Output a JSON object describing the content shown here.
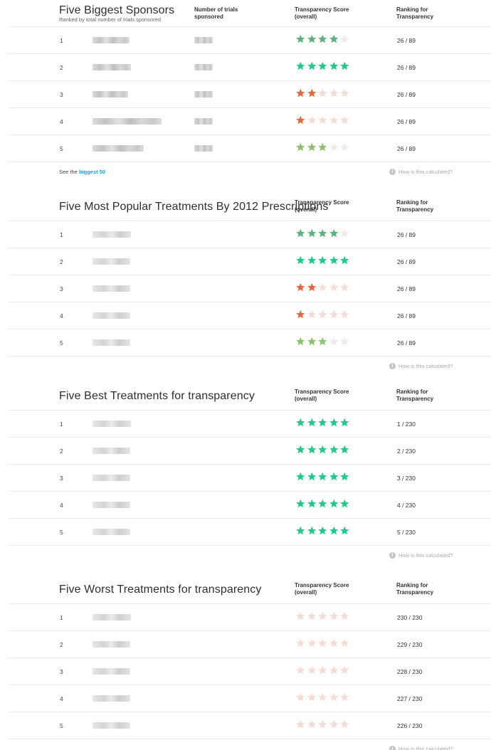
{
  "colors": {
    "star_green_bright": "#21c98a",
    "star_green_mid": "#5bb37f",
    "star_green_olive": "#8ec26a",
    "star_orange": "#e8683a",
    "star_empty_green": "#e4f1e2",
    "star_empty_pink": "#fadbd3",
    "link_blue": "#1a9fd6"
  },
  "common": {
    "col_score": "Transparency Score\n(overall)",
    "col_rank": "Ranking for\nTransparency",
    "how_calc": "How is this calculated?"
  },
  "sponsors": {
    "title": "Five Biggest Sponsors",
    "subtitle": "Ranked by total number of trials sponsored",
    "col_trials": "Number of trials\nsponsored",
    "see_prefix": "See the",
    "see_link": "biggest 50",
    "rows": [
      {
        "rank": "1",
        "stars": 4,
        "palette": "mid",
        "ranking": "26 / 89"
      },
      {
        "rank": "2",
        "stars": 5,
        "palette": "bright",
        "ranking": "26 / 89"
      },
      {
        "rank": "3",
        "stars": 2,
        "palette": "orange",
        "ranking": "26 / 89"
      },
      {
        "rank": "4",
        "stars": 1,
        "palette": "orange",
        "ranking": "26 / 89"
      },
      {
        "rank": "5",
        "stars": 3,
        "palette": "olive",
        "ranking": "26 / 89"
      }
    ]
  },
  "popular": {
    "title": "Five Most Popular Treatments By 2012 Prescriptions",
    "rows": [
      {
        "rank": "1",
        "stars": 4,
        "palette": "mid",
        "ranking": "26 / 89"
      },
      {
        "rank": "2",
        "stars": 5,
        "palette": "bright",
        "ranking": "26 / 89"
      },
      {
        "rank": "3",
        "stars": 2,
        "palette": "orange",
        "ranking": "26 / 89"
      },
      {
        "rank": "4",
        "stars": 1,
        "palette": "orange",
        "ranking": "26 / 89"
      },
      {
        "rank": "5",
        "stars": 3,
        "palette": "olive",
        "ranking": "26 / 89"
      }
    ]
  },
  "best": {
    "title": "Five Best Treatments for transparency",
    "rows": [
      {
        "rank": "1",
        "stars": 5,
        "palette": "bright",
        "ranking": "1 / 230"
      },
      {
        "rank": "2",
        "stars": 5,
        "palette": "bright",
        "ranking": "2 / 230"
      },
      {
        "rank": "3",
        "stars": 5,
        "palette": "bright",
        "ranking": "3 / 230"
      },
      {
        "rank": "4",
        "stars": 5,
        "palette": "bright",
        "ranking": "4 / 230"
      },
      {
        "rank": "5",
        "stars": 5,
        "palette": "bright",
        "ranking": "5 / 230"
      }
    ]
  },
  "worst": {
    "title": "Five Worst Treatments for transparency",
    "rows": [
      {
        "rank": "1",
        "stars": 0,
        "palette": "pink",
        "ranking": "230 / 230"
      },
      {
        "rank": "2",
        "stars": 0,
        "palette": "pink",
        "ranking": "229 / 230"
      },
      {
        "rank": "3",
        "stars": 0,
        "palette": "pink",
        "ranking": "228 / 230"
      },
      {
        "rank": "4",
        "stars": 0,
        "palette": "pink",
        "ranking": "227 / 230"
      },
      {
        "rank": "5",
        "stars": 0,
        "palette": "pink",
        "ranking": "226 / 230"
      }
    ]
  }
}
